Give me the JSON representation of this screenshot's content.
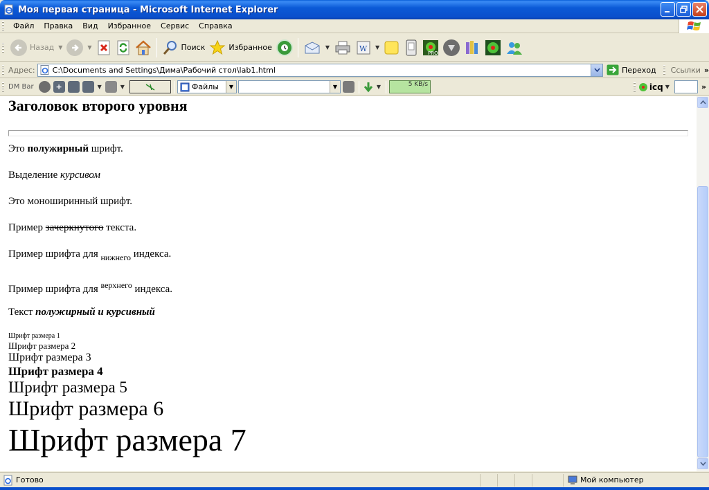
{
  "window": {
    "title": "Моя первая страница - Microsoft Internet Explorer"
  },
  "menu": {
    "items": [
      "Файл",
      "Правка",
      "Вид",
      "Избранное",
      "Сервис",
      "Справка"
    ]
  },
  "toolbar": {
    "back_label": "Назад",
    "search_label": "Поиск",
    "favorites_label": "Избранное"
  },
  "address": {
    "label": "Адрес:",
    "url": "C:\\Documents and Settings\\Дима\\Рабочий стол\\lab1.html",
    "go_label": "Переход",
    "links_label": "Ссылки"
  },
  "dmbar": {
    "label": "DM Bar",
    "files_label": "Файлы",
    "speed": "5 KB/s",
    "icq_label": "icq"
  },
  "page": {
    "heading": "Заголовок второго уровня",
    "bold_line": {
      "before": "Это ",
      "bold": "полужирный",
      "after": " шрифт."
    },
    "italic_line": {
      "before": "Выделение ",
      "italic": "курсивом"
    },
    "mono_line": "Это моноширинный шрифт.",
    "strike_line": {
      "before": "Пример ",
      "strike": "зачеркнутого",
      "after": " текста."
    },
    "sub_line": {
      "before": "Пример шрифта для ",
      "sub": "нижнего",
      "after": " индекса."
    },
    "sup_line": {
      "before": "Пример шрифта для ",
      "sup": "верхнего",
      "after": " индекса."
    },
    "bolditalic_line": {
      "before": "Текст ",
      "bi": "полужирный и курсивный"
    },
    "font_sizes": [
      "Шрифт размера 1",
      "Шрифт размера 2",
      "Шрифт размера 3",
      "Шрифт размера 4",
      "Шрифт размера 5",
      "Шрифт размера 6",
      "Шрифт размера 7"
    ]
  },
  "status": {
    "text": "Готово",
    "zone": "Мой компьютер"
  },
  "colors": {
    "title_blue": "#0a4fcc",
    "scroll_blue": "#c9d9fb"
  }
}
